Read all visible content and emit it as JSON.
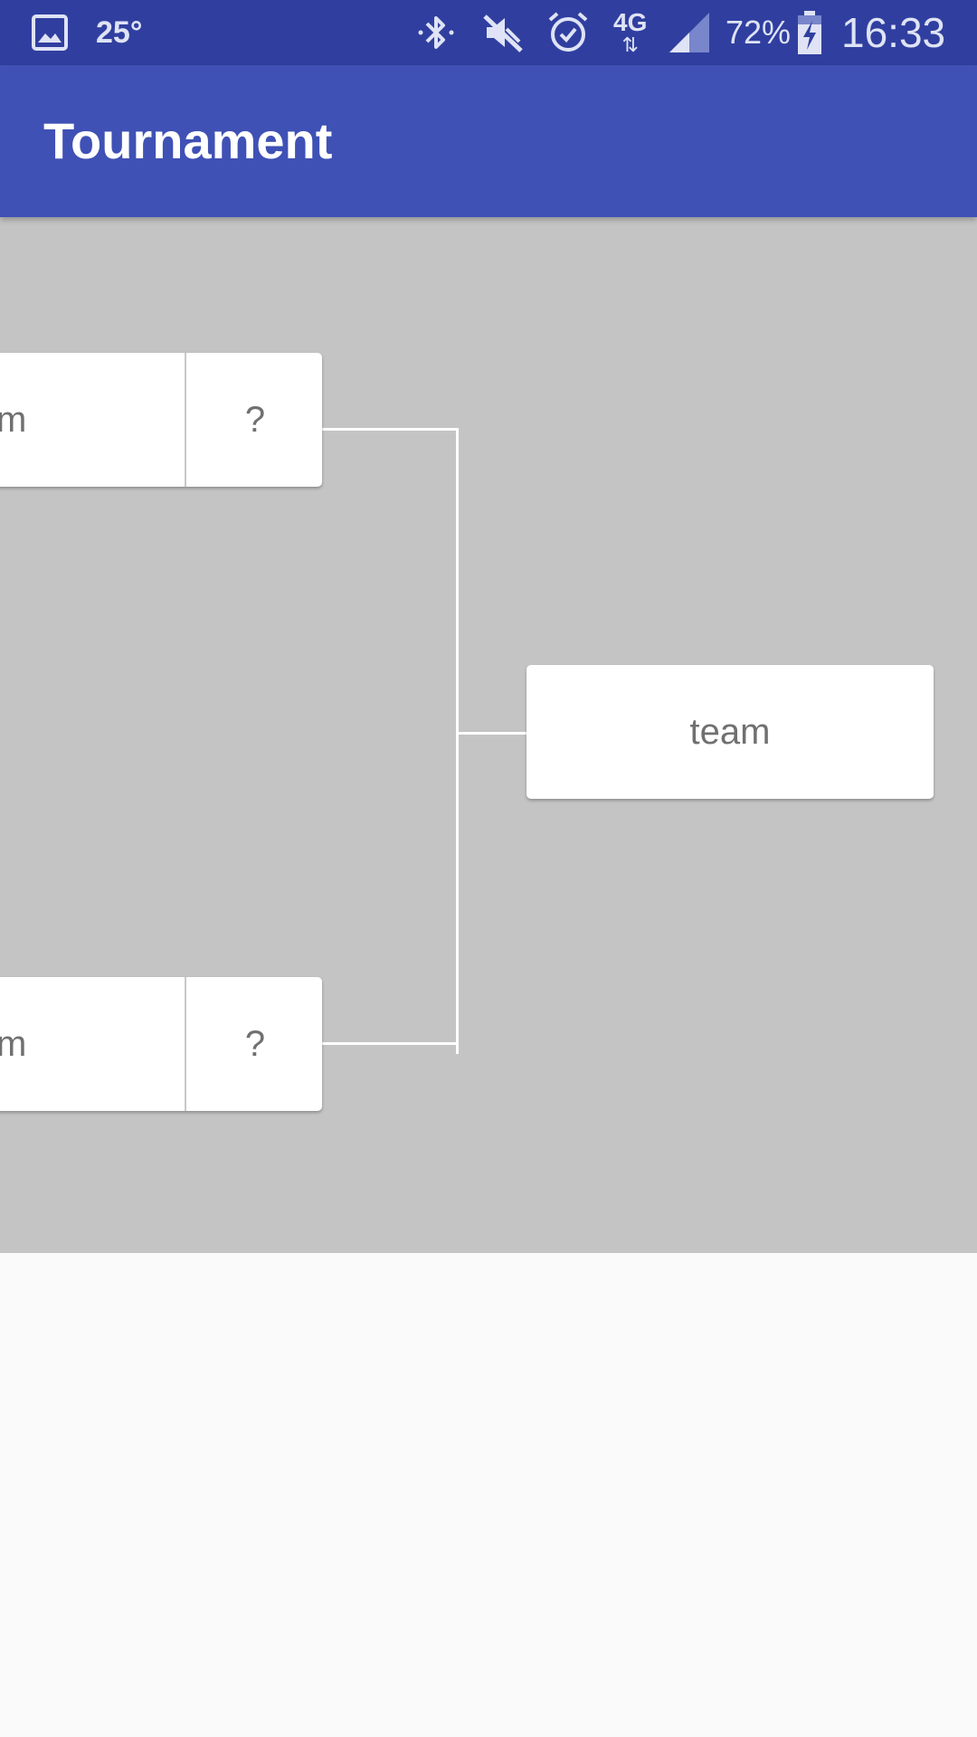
{
  "status_bar": {
    "temperature": "25°",
    "network": "4G",
    "battery": "72%",
    "time": "16:33",
    "icons": [
      "gallery-icon",
      "bluetooth-icon",
      "mute-icon",
      "alarm-icon",
      "data-arrows-icon",
      "signal-icon",
      "battery-charging-icon"
    ]
  },
  "app_bar": {
    "title": "Tournament"
  },
  "bracket": {
    "round1": [
      {
        "team": "m",
        "score": "?"
      },
      {
        "team": "m",
        "score": "?"
      }
    ],
    "round2": {
      "team": "team"
    }
  },
  "colors": {
    "status_bar": "#303f9f",
    "app_bar": "#3f51b5",
    "bracket_background": "#c4c4c4",
    "card": "#ffffff",
    "card_text": "#707070",
    "page_background": "#fafafa"
  }
}
